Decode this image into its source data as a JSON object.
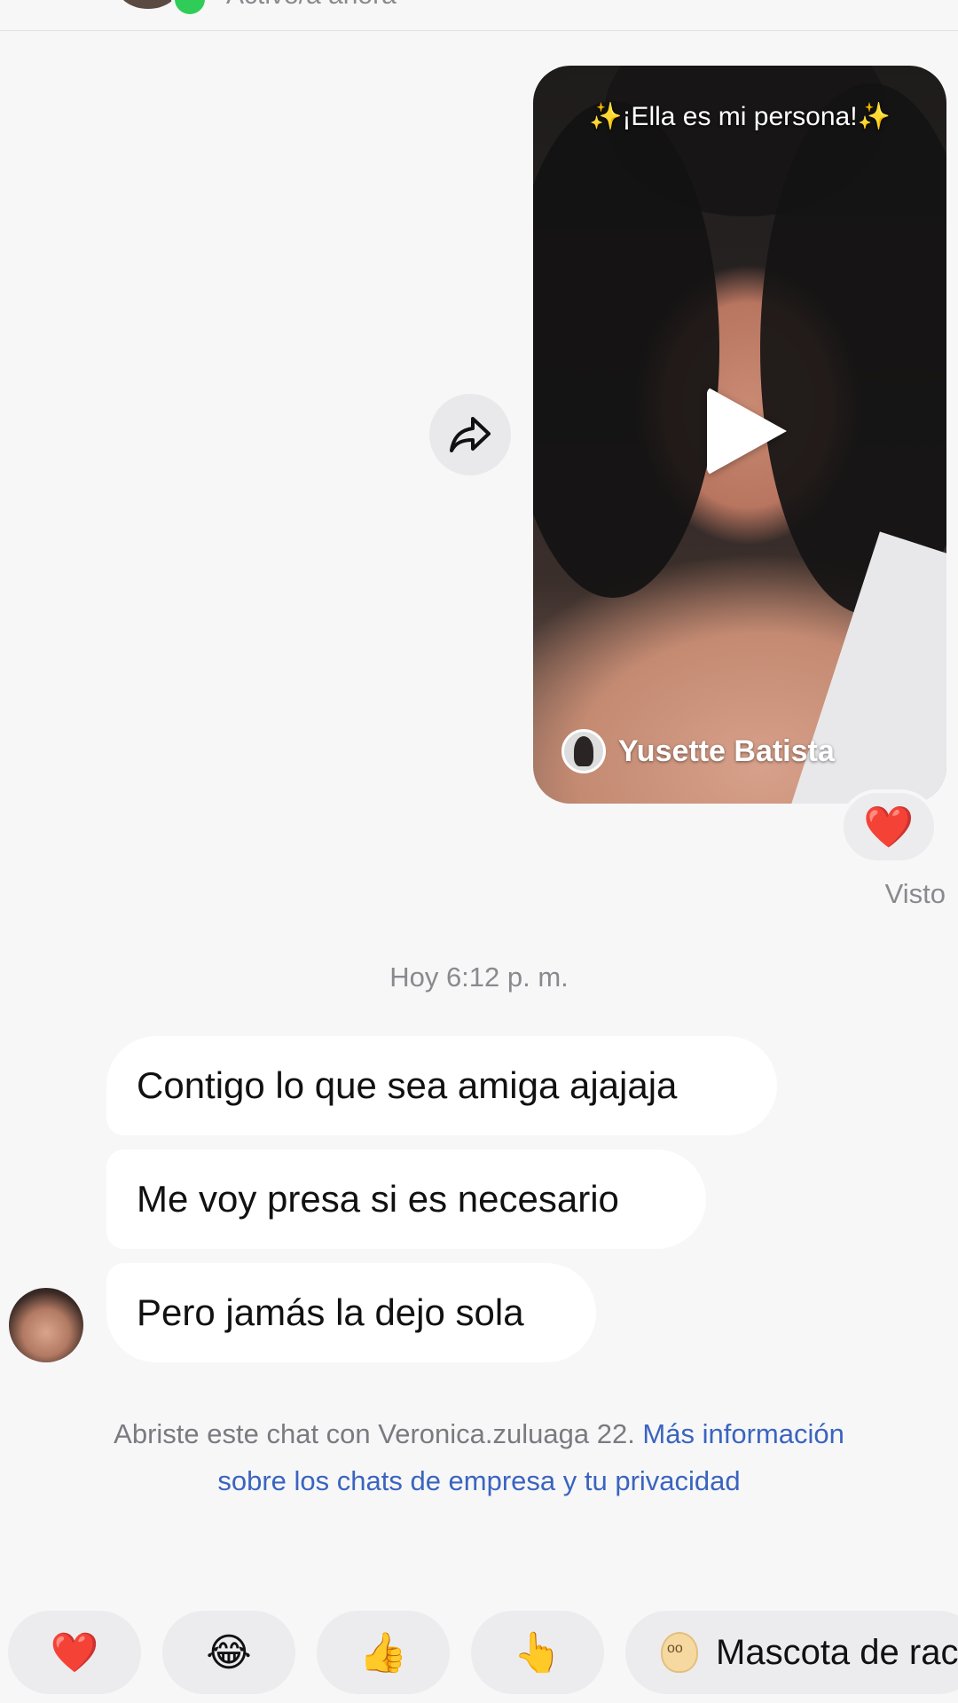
{
  "header": {
    "status_text": "Activo/a ahora"
  },
  "shared_video": {
    "caption": "¡Ella es mi persona!",
    "caption_spark": "✨",
    "author_name": "Yusette Batista",
    "play_icon": "play-icon",
    "share_icon": "share-arrow-icon"
  },
  "reaction": {
    "emoji": "❤️",
    "seen_label": "Visto"
  },
  "timestamp": "Hoy 6:12 p. m.",
  "messages": [
    {
      "text": "Contigo lo que sea amiga ajajaja"
    },
    {
      "text": "Me voy presa si es necesario"
    },
    {
      "text": "Pero jamás la dejo sola"
    }
  ],
  "info": {
    "text": "Abriste este chat con Veronica.zuluaga 22. ",
    "link": "Más información sobre los chats de empresa y tu privacidad"
  },
  "quick_replies": [
    {
      "emoji": "❤️"
    },
    {
      "emoji": "😂"
    },
    {
      "emoji": "👍"
    },
    {
      "emoji": "👆"
    },
    {
      "icon": "mascot-icon",
      "label": "Mascota de rac"
    }
  ],
  "colors": {
    "background": "#f7f7f8",
    "bubble": "#ffffff",
    "link": "#3a64c0",
    "online": "#2fcd57",
    "muted_text": "#8a8a8e"
  }
}
